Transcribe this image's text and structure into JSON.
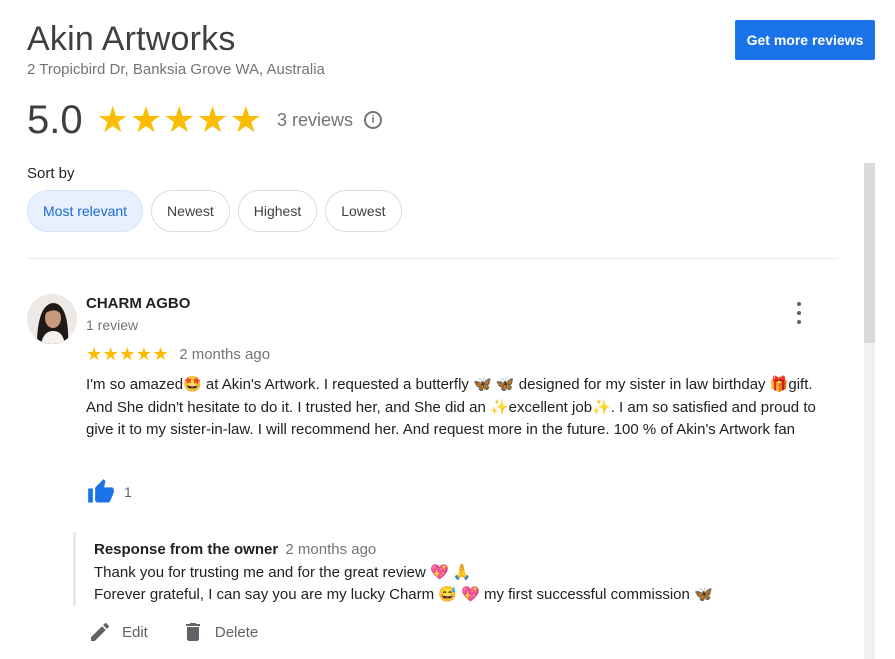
{
  "business": {
    "name": "Akin Artworks",
    "address": "2 Tropicbird Dr, Banksia Grove WA, Australia"
  },
  "header": {
    "get_more_reviews_label": "Get more reviews"
  },
  "rating": {
    "score": "5.0",
    "stars": "★★★★★",
    "count_label": "3 reviews",
    "info_glyph": "i"
  },
  "sort": {
    "label": "Sort by",
    "options": [
      {
        "label": "Most relevant",
        "selected": true
      },
      {
        "label": "Newest",
        "selected": false
      },
      {
        "label": "Highest",
        "selected": false
      },
      {
        "label": "Lowest",
        "selected": false
      }
    ]
  },
  "review": {
    "reviewer_name": "CHARM AGBO",
    "reviewer_meta": "1 review",
    "stars": "★★★★★",
    "time": "2 months ago",
    "text": "I'm so amazed🤩 at Akin's Artwork. I requested a butterfly 🦋 🦋 designed for my sister in law birthday 🎁gift. And She didn't hesitate to do it. I trusted her, and She  did an ✨excellent job✨. I am so satisfied and proud to give it to my sister-in-law. I will recommend her. And request more in the future. 100 % of Akin's Artwork fan",
    "like_count": "1"
  },
  "owner_response": {
    "title": "Response from the owner",
    "time": "2 months ago",
    "line1": "Thank you for trusting me and for the great review 💖 🙏",
    "line2": "Forever grateful, I can say you are my lucky Charm 😅 💖  my first successful commission 🦋"
  },
  "actions": {
    "edit_label": "Edit",
    "delete_label": "Delete"
  },
  "colors": {
    "accent": "#1a73e8",
    "star": "#fbbc04",
    "chip_selected_bg": "#e8f0fe",
    "chip_selected_text": "#1967d2",
    "secondary_text": "#70757a"
  }
}
